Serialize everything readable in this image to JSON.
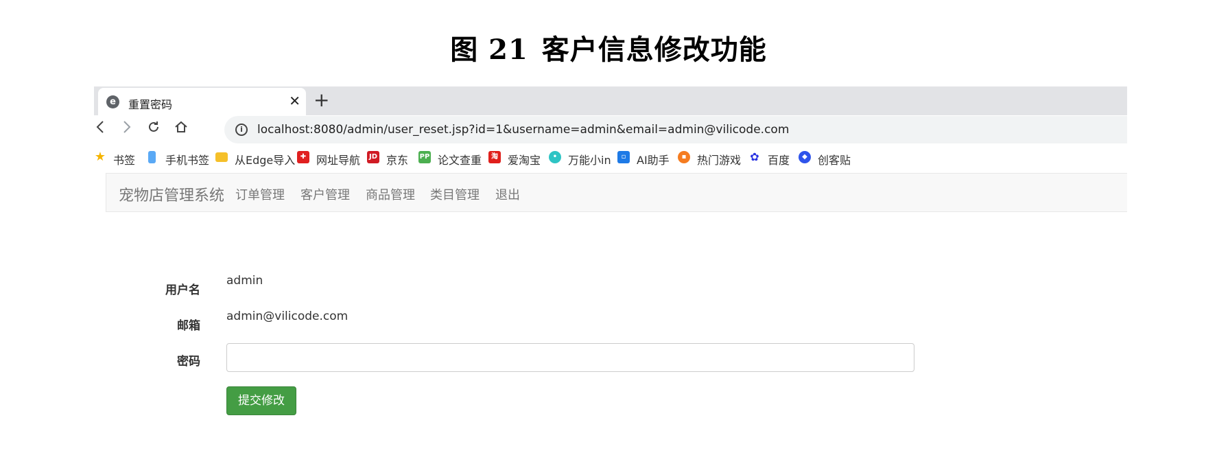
{
  "figure": {
    "label": "图",
    "number": "21",
    "caption": "客户信息修改功能"
  },
  "browser": {
    "tab_title": "重置密码",
    "tab_icon": "edge-icon",
    "new_tab_symbol": "+",
    "close_symbol": "✕",
    "url": "localhost:8080/admin/user_reset.jsp?id=1&username=admin&email=admin@vilicode.com",
    "bookmarks": [
      {
        "label": "书签",
        "icon": "star-icon",
        "color": "#f5b400"
      },
      {
        "label": "手机书签",
        "icon": "phone-icon",
        "color": "#5aa9f5"
      },
      {
        "label": "从Edge导入",
        "icon": "folder-icon",
        "color": "#f5c02a"
      },
      {
        "label": "网址导航",
        "icon": "navigation-site-icon",
        "color": "#e02020"
      },
      {
        "label": "京东",
        "icon": "jd-icon",
        "color": "#d01b24"
      },
      {
        "label": "论文查重",
        "icon": "pp-icon",
        "color": "#4caf50"
      },
      {
        "label": "爱淘宝",
        "icon": "taobao-icon",
        "color": "#e0201c"
      },
      {
        "label": "万能小in",
        "icon": "robot-icon",
        "color": "#2ec4c4"
      },
      {
        "label": "AI助手",
        "icon": "ai-assistant-icon",
        "color": "#1e7ae6"
      },
      {
        "label": "热门游戏",
        "icon": "game-icon",
        "color": "#f57c20"
      },
      {
        "label": "百度",
        "icon": "baidu-icon",
        "color": "#2932e1"
      },
      {
        "label": "创客贴",
        "icon": "chuangketie-icon",
        "color": "#2f54eb"
      }
    ]
  },
  "app": {
    "brand": "宠物店管理系统",
    "nav": [
      "订单管理",
      "客户管理",
      "商品管理",
      "类目管理",
      "退出"
    ],
    "form": {
      "username_label": "用户名",
      "username_value": "admin",
      "email_label": "邮箱",
      "email_value": "admin@vilicode.com",
      "password_label": "密码",
      "password_value": "",
      "submit_label": "提交修改"
    }
  },
  "colors": {
    "submit_button": "#449d44",
    "navbar_bg": "#f8f8f8",
    "tabstrip_bg": "#e2e3e6"
  }
}
